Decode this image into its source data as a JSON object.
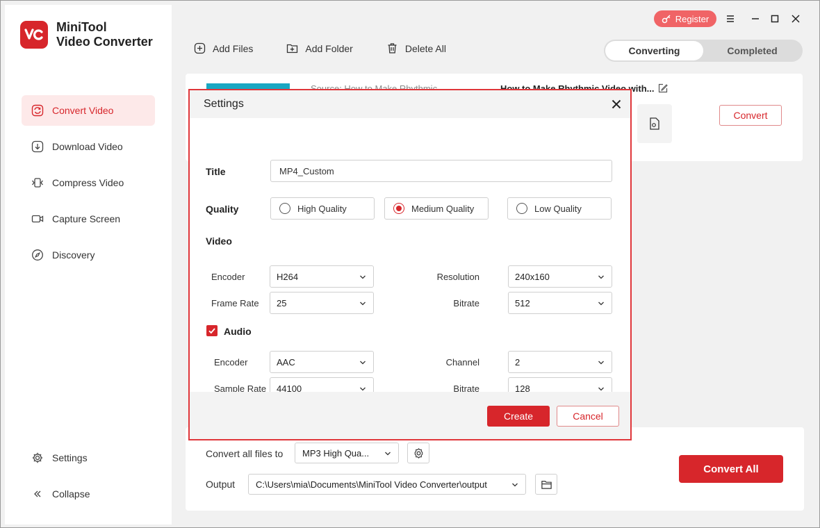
{
  "app": {
    "title_line1": "MiniTool",
    "title_line2": "Video Converter",
    "logo_letters": "VC",
    "accent": "#d7262b"
  },
  "sidebar": {
    "items": [
      {
        "label": "Convert Video",
        "icon": "convert-icon",
        "active": true
      },
      {
        "label": "Download Video",
        "icon": "download-icon"
      },
      {
        "label": "Compress Video",
        "icon": "compress-icon"
      },
      {
        "label": "Capture Screen",
        "icon": "camera-icon"
      },
      {
        "label": "Discovery",
        "icon": "compass-icon"
      }
    ],
    "bottom": [
      {
        "label": "Settings",
        "icon": "gear-icon"
      },
      {
        "label": "Collapse",
        "icon": "collapse-icon"
      }
    ]
  },
  "topbar": {
    "register_label": "Register"
  },
  "toolbar": {
    "add_files": "Add Files",
    "add_folder": "Add Folder",
    "delete_all": "Delete All"
  },
  "tabs": {
    "converting": "Converting",
    "completed": "Completed",
    "active": "converting"
  },
  "file": {
    "source": "Source:  How to Make Rhythmic",
    "target": "How to Make Rhythmic Video with...",
    "convert_label": "Convert"
  },
  "bottom": {
    "convert_all_label": "Convert all files to",
    "format_value": "MP3 High Qua...",
    "output_label": "Output",
    "output_path": "C:\\Users\\mia\\Documents\\MiniTool Video Converter\\output",
    "convert_all_button": "Convert All"
  },
  "settings": {
    "heading": "Settings",
    "title_label": "Title",
    "title_value": "MP4_Custom",
    "quality_label": "Quality",
    "quality_options": [
      {
        "label": "High Quality",
        "selected": false
      },
      {
        "label": "Medium Quality",
        "selected": true
      },
      {
        "label": "Low Quality",
        "selected": false
      }
    ],
    "video_label": "Video",
    "video": {
      "encoder_label": "Encoder",
      "encoder_value": "H264",
      "resolution_label": "Resolution",
      "resolution_value": "240x160",
      "frame_rate_label": "Frame Rate",
      "frame_rate_value": "25",
      "bitrate_label": "Bitrate",
      "bitrate_value": "512"
    },
    "audio_label": "Audio",
    "audio_checked": true,
    "audio": {
      "encoder_label": "Encoder",
      "encoder_value": "AAC",
      "channel_label": "Channel",
      "channel_value": "2",
      "sample_rate_label": "Sample Rate",
      "sample_rate_value": "44100",
      "bitrate_label": "Bitrate",
      "bitrate_value": "128"
    },
    "create_button": "Create",
    "cancel_button": "Cancel"
  }
}
